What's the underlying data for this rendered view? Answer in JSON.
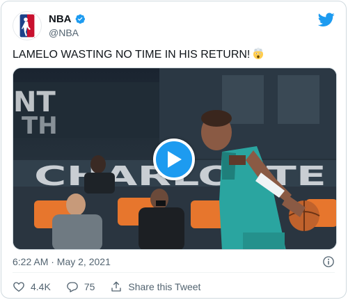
{
  "author": {
    "display_name": "NBA",
    "handle": "@NBA",
    "avatar_icon": "nba-logo-icon",
    "verified_icon": "verified-badge-icon"
  },
  "brand": {
    "icon": "twitter-bird-icon",
    "color": "#1d9bf0"
  },
  "tweet": {
    "text": "LAMELO WASTING NO TIME IN HIS RETURN!",
    "emoji_icon": "astonished-exploding-face-emoji",
    "timestamp": "6:22 AM · May 2, 2021"
  },
  "media": {
    "type": "video",
    "play_icon": "play-icon",
    "scene_text": "CHARLOTTE"
  },
  "actions": {
    "like_count": "4.4K",
    "reply_count": "75",
    "share_label": "Share this Tweet"
  },
  "colors": {
    "text_primary": "#0f1419",
    "text_secondary": "#536471",
    "border": "#cfd9de",
    "jersey": "#2aa5a0"
  }
}
